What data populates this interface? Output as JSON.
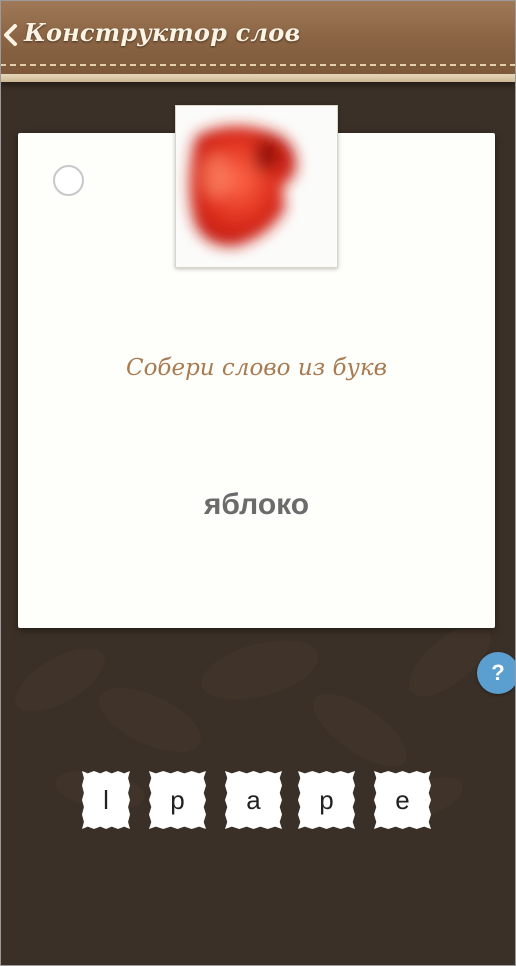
{
  "header": {
    "title": "Конструктор слов",
    "back_icon": "chevron-left-icon"
  },
  "card": {
    "image_icon": "apple-photo",
    "prompt": "Собери слово из букв",
    "word": "яблоко"
  },
  "help_button": {
    "label": "?"
  },
  "letter_tiles": [
    "l",
    "p",
    "a",
    "p",
    "e"
  ],
  "colors": {
    "background": "#3b3027",
    "header_leather": "#8b6544",
    "card": "#fefefa",
    "prompt_text": "#a87b52",
    "word_text": "#6b6b6b",
    "help_button": "#5b9fd1"
  }
}
